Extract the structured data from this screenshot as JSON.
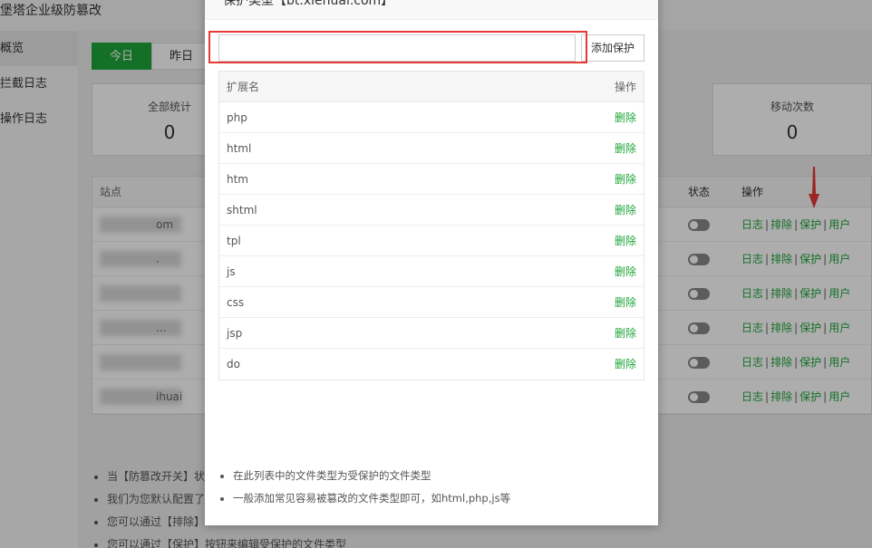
{
  "app": {
    "title": "堡塔企业级防篡改"
  },
  "sidebar": {
    "items": [
      {
        "label": "概览"
      },
      {
        "label": "拦截日志"
      },
      {
        "label": "操作日志"
      }
    ]
  },
  "tabs": [
    {
      "label": "今日"
    },
    {
      "label": "昨日"
    }
  ],
  "stats": [
    {
      "label": "全部统计",
      "value": "0"
    },
    {
      "label": "移动次数",
      "value": "0"
    }
  ],
  "site_table": {
    "headers": {
      "site": "站点",
      "status": "状态",
      "ops": "操作"
    },
    "rows": [
      {
        "site": "om"
      },
      {
        "site": "."
      },
      {
        "site": ""
      },
      {
        "site": "..."
      },
      {
        "site": ""
      },
      {
        "site": "ihuai"
      }
    ],
    "ops": {
      "log": "日志",
      "exclude": "排除",
      "protect": "保护",
      "user": "用户",
      "sep": "|"
    }
  },
  "notes": [
    "当【防篡改开关】状",
    "我们为您默认配置了",
    "您可以通过【排除】",
    "您可以通过【保护】按钮来编辑受保护的文件类型"
  ],
  "modal": {
    "title": "保护类型【bt.xienuai.com】",
    "input": {
      "value": "",
      "placeholder": ""
    },
    "add_button": "添加保护",
    "table": {
      "header_name": "扩展名",
      "header_op": "操作",
      "rows": [
        {
          "ext": "php",
          "op": "删除"
        },
        {
          "ext": "html",
          "op": "删除"
        },
        {
          "ext": "htm",
          "op": "删除"
        },
        {
          "ext": "shtml",
          "op": "删除"
        },
        {
          "ext": "tpl",
          "op": "删除"
        },
        {
          "ext": "js",
          "op": "删除"
        },
        {
          "ext": "css",
          "op": "删除"
        },
        {
          "ext": "jsp",
          "op": "删除"
        },
        {
          "ext": "do",
          "op": "删除"
        }
      ]
    },
    "notes": [
      "在此列表中的文件类型为受保护的文件类型",
      "一般添加常见容易被篡改的文件类型即可，如html,php,js等"
    ]
  },
  "colors": {
    "accent": "#20a53a",
    "highlight": "#e53935"
  }
}
